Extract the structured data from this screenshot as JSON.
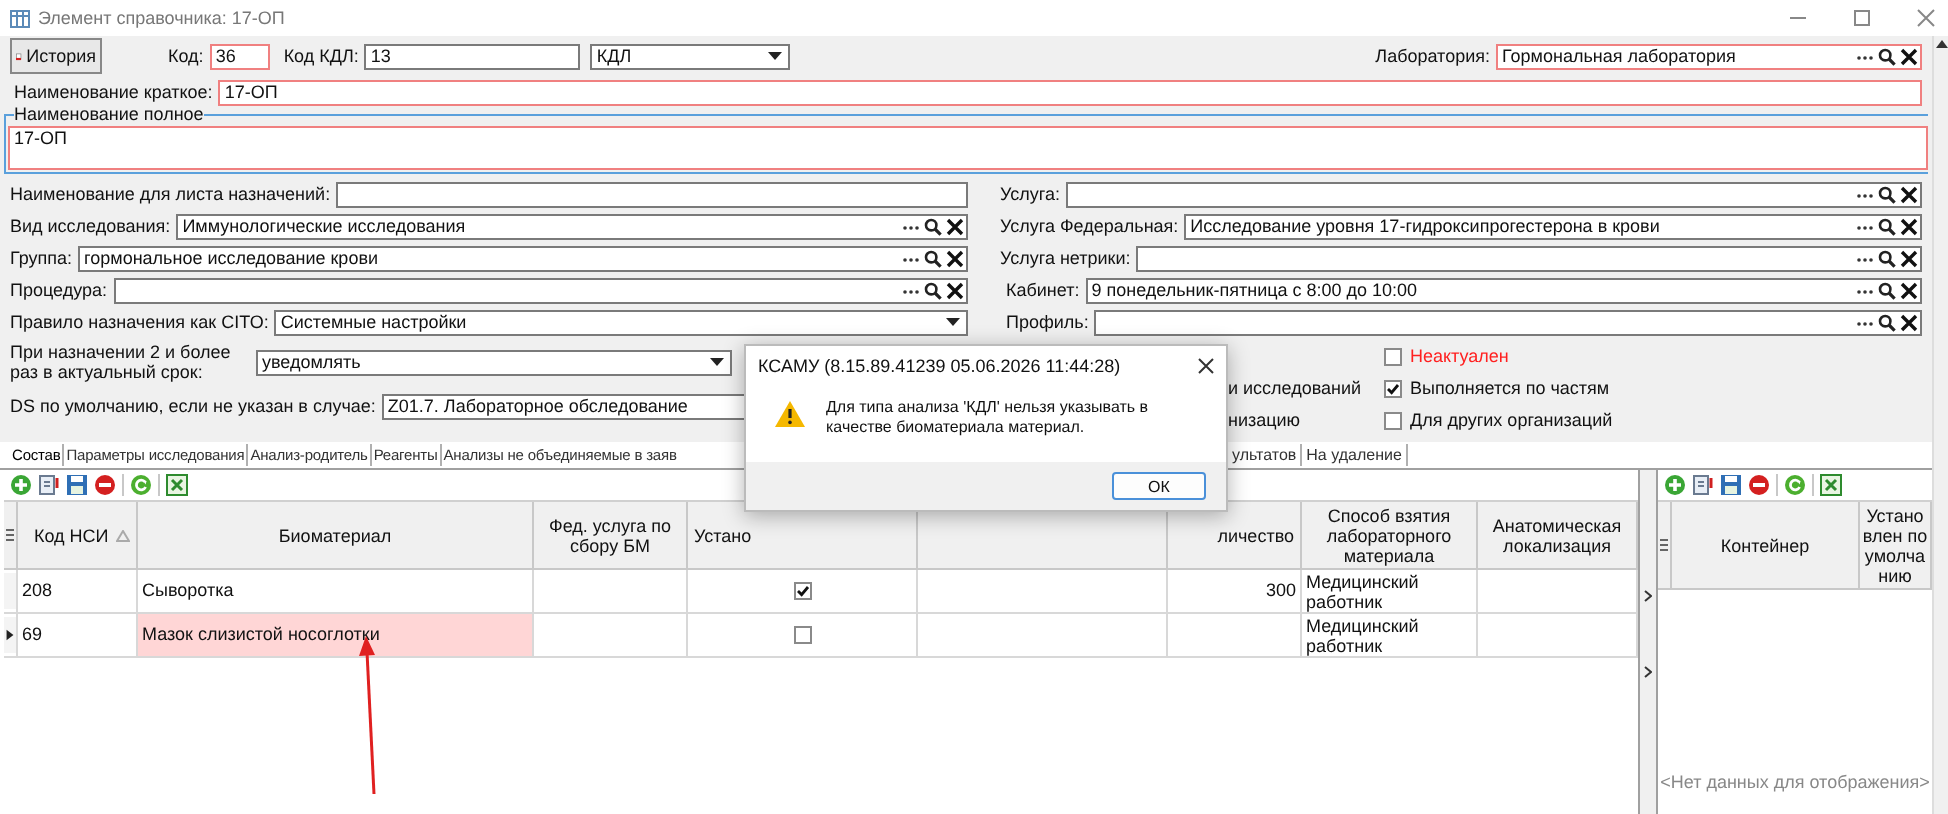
{
  "window": {
    "title": "Элемент справочника: 17-ОП"
  },
  "top": {
    "history_button": "История",
    "code": {
      "label": "Код:",
      "value": "36",
      "required": true
    },
    "code_kdl": {
      "label": "Код КДЛ:",
      "value": "13",
      "required": false
    },
    "type_select": {
      "value": "КДЛ"
    },
    "lab": {
      "label": "Лаборатория:",
      "value": "Гормональная лаборатория",
      "required": true
    }
  },
  "short_name": {
    "label": "Наименование краткое:",
    "value": "17-ОП",
    "required": true
  },
  "full_name": {
    "label": "Наименование полное",
    "value": "17-ОП",
    "required": true
  },
  "left_fields": [
    {
      "kind": "text",
      "label": "Наименование для листа назначений:"
    },
    {
      "kind": "lookup",
      "label": "Вид исследования:",
      "value": "Иммунологические исследования"
    },
    {
      "kind": "lookup",
      "label": "Группа:",
      "value": "гормональное исследование крови"
    },
    {
      "kind": "lookup",
      "label": "Процедура:"
    },
    {
      "kind": "select",
      "label": "Правило назначения как CITO:",
      "value": "Системные настройки"
    },
    {
      "kind": "select",
      "label": "При назначении 2 и более раз в актуальный срок:",
      "value": "уведомлять"
    },
    {
      "kind": "text",
      "label": "DS по умолчанию, если не указан в случае:",
      "value": "Z01.7. Лабораторное обследование"
    }
  ],
  "right_fields": [
    {
      "kind": "lookup",
      "label": "Услуга:"
    },
    {
      "kind": "lookup",
      "label": "Услуга Федеральная:",
      "value": "Исследование уровня 17-гидроксипрогестерона в крови"
    },
    {
      "kind": "lookup",
      "label": "Услуга нетрики:"
    },
    {
      "kind": "lookup",
      "label": "Кабинет:",
      "value": "9  понедельник-пятница с 8:00 до 10:00"
    },
    {
      "kind": "lookup",
      "label": "Профиль:"
    }
  ],
  "partial_checks": [
    {
      "label": "и исследований"
    },
    {
      "label": "низацию"
    }
  ],
  "flags": [
    {
      "label": "Неактуален",
      "checked": false,
      "alert": true
    },
    {
      "label": "Выполняется по частям",
      "checked": true,
      "alert": false
    },
    {
      "label": "Для других организаций",
      "checked": false,
      "alert": false
    }
  ],
  "tabs": {
    "left": [
      {
        "label": "Состав",
        "selected": true
      },
      {
        "label": "Параметры исследования",
        "selected": false
      },
      {
        "label": "Анализ-родитель",
        "selected": false
      },
      {
        "label": "Реагенты",
        "selected": false
      },
      {
        "label": "Анализы не объединяемые в заяв",
        "selected": false
      }
    ],
    "right": [
      {
        "label": "ультатов",
        "selected": false
      },
      {
        "label": "На удаление",
        "selected": false
      }
    ]
  },
  "grid": {
    "columns": [
      {
        "label": "Код НСИ",
        "sorted": true
      },
      {
        "label": "Биоматериал"
      },
      {
        "label": "Фед. услуга по сбору БМ"
      },
      {
        "label": "Устано"
      },
      {},
      {
        "label": "личество"
      },
      {
        "label": "Способ взятия лабораторного материала"
      },
      {
        "label": "Анатомическая локализация"
      }
    ],
    "rows": [
      {
        "code": "208",
        "biomaterial": "Сыворотка",
        "default": true,
        "quantity": "300",
        "method": "Медицинский работник",
        "current": false,
        "error": false
      },
      {
        "code": "69",
        "biomaterial": "Мазок слизистой носоглотки",
        "default": false,
        "method": "Медицинский работник",
        "current": true,
        "error": true
      }
    ]
  },
  "containers": {
    "columns": [
      {
        "label": "Контейнер"
      },
      {
        "label": "Установлен по умолчанию"
      }
    ],
    "empty_text": "<Нет данных для отображения>"
  },
  "dialog": {
    "title": "КСАМУ (8.15.89.41239 05.06.2026 11:44:28)",
    "message": "Для типа анализа 'КДЛ' нельзя указывать в качестве биоматериала материал.",
    "button": "ОК"
  }
}
